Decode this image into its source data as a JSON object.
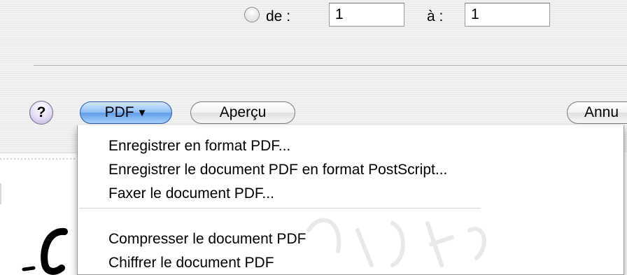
{
  "page_range": {
    "from_label": "de :",
    "from_value": "1",
    "to_label": "à :",
    "to_value": "1"
  },
  "buttons": {
    "help_label": "?",
    "pdf_label": "PDF",
    "pdf_arrow": "▼",
    "preview_label": "Aperçu",
    "cancel_label": "Annu"
  },
  "pdf_menu": {
    "items": [
      "Enregistrer en format PDF...",
      "Enregistrer le document PDF en format PostScript...",
      "Faxer le document PDF...",
      "Compresser le document PDF",
      "Chiffrer le document PDF"
    ]
  },
  "colors": {
    "pdf_button": "#8fc0f4",
    "help_button": "#d6cbf0",
    "dialog_bg": "#ececec"
  }
}
